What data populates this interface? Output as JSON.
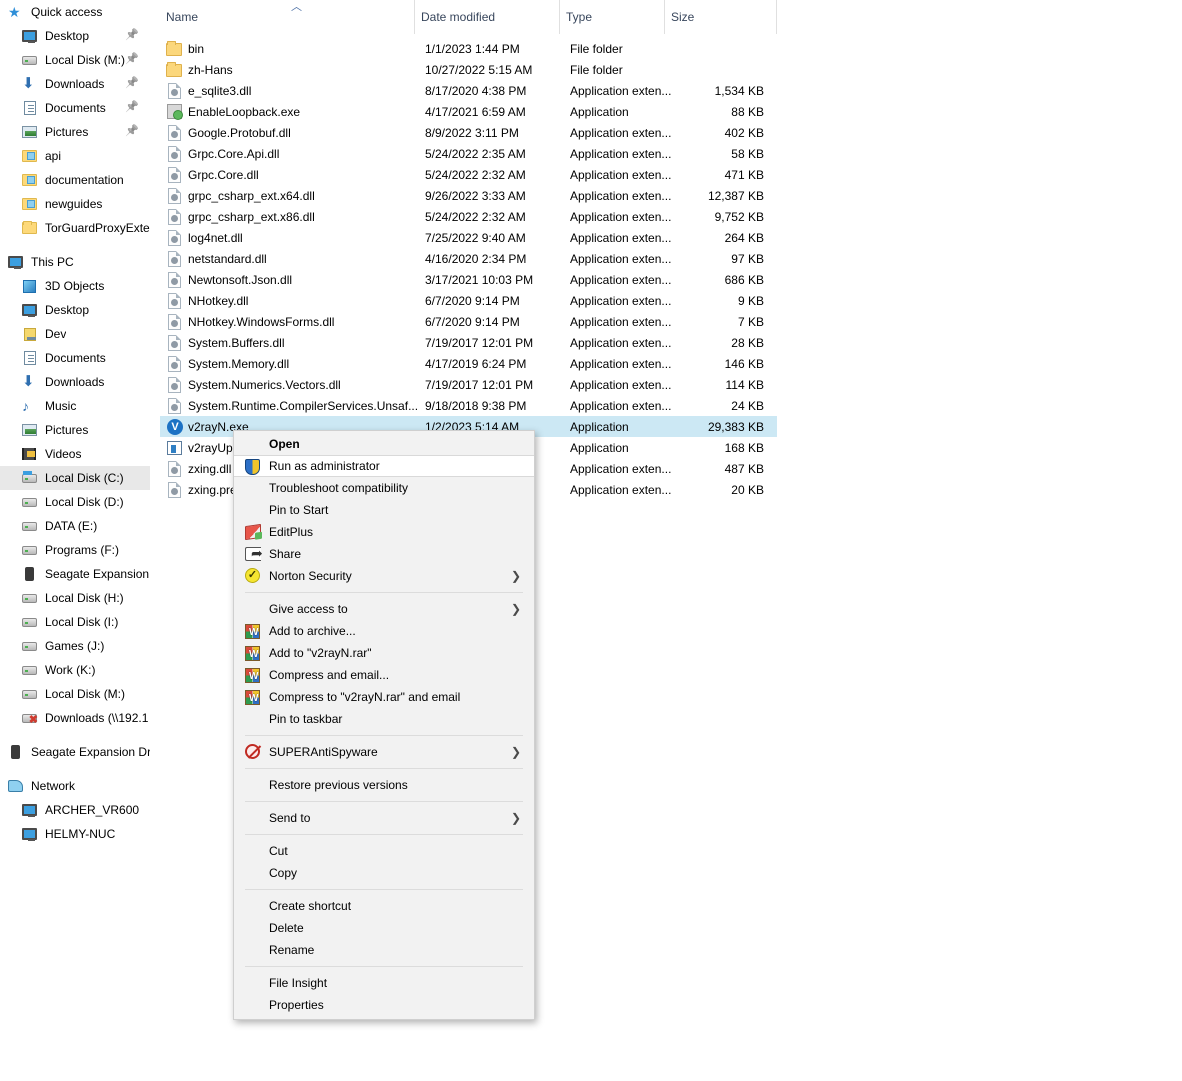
{
  "sidebar": {
    "groups": [
      {
        "name": "quick-access",
        "header": {
          "label": "Quick access",
          "icon": "star-icon",
          "level": 0
        },
        "items": [
          {
            "label": "Desktop",
            "icon": "monitor-icon",
            "pinned": true,
            "level": 1
          },
          {
            "label": "Local Disk (M:)",
            "icon": "drive-icon",
            "pinned": true,
            "level": 1
          },
          {
            "label": "Downloads",
            "icon": "download-arrow-icon",
            "pinned": true,
            "level": 1
          },
          {
            "label": "Documents",
            "icon": "documents-icon",
            "pinned": true,
            "level": 1
          },
          {
            "label": "Pictures",
            "icon": "pictures-icon",
            "pinned": true,
            "level": 1
          },
          {
            "label": "api",
            "icon": "folder-link-icon",
            "pinned": false,
            "level": 1
          },
          {
            "label": "documentation",
            "icon": "folder-link-icon",
            "pinned": false,
            "level": 1
          },
          {
            "label": "newguides",
            "icon": "folder-link-icon",
            "pinned": false,
            "level": 1
          },
          {
            "label": "TorGuardProxyExten",
            "icon": "folder-icon",
            "pinned": false,
            "level": 1
          }
        ]
      },
      {
        "name": "this-pc",
        "header": {
          "label": "This PC",
          "icon": "computer-icon",
          "level": 0
        },
        "items": [
          {
            "label": "3D Objects",
            "icon": "3d-objects-icon",
            "level": 1
          },
          {
            "label": "Desktop",
            "icon": "monitor-icon",
            "level": 1
          },
          {
            "label": "Dev",
            "icon": "dev-folder-icon",
            "level": 1
          },
          {
            "label": "Documents",
            "icon": "documents-icon",
            "level": 1
          },
          {
            "label": "Downloads",
            "icon": "download-arrow-icon",
            "level": 1
          },
          {
            "label": "Music",
            "icon": "music-note-icon",
            "level": 1
          },
          {
            "label": "Pictures",
            "icon": "pictures-icon",
            "level": 1
          },
          {
            "label": "Videos",
            "icon": "videos-icon",
            "level": 1
          },
          {
            "label": "Local Disk (C:)",
            "icon": "system-drive-icon",
            "level": 1,
            "selected": true
          },
          {
            "label": "Local Disk (D:)",
            "icon": "drive-icon",
            "level": 1
          },
          {
            "label": "DATA (E:)",
            "icon": "drive-icon",
            "level": 1
          },
          {
            "label": "Programs (F:)",
            "icon": "drive-icon",
            "level": 1
          },
          {
            "label": "Seagate Expansion I",
            "icon": "external-drive-icon",
            "level": 1
          },
          {
            "label": "Local Disk (H:)",
            "icon": "drive-icon",
            "level": 1
          },
          {
            "label": "Local Disk (I:)",
            "icon": "drive-icon",
            "level": 1
          },
          {
            "label": "Games (J:)",
            "icon": "drive-icon",
            "level": 1
          },
          {
            "label": "Work (K:)",
            "icon": "drive-icon",
            "level": 1
          },
          {
            "label": "Local Disk (M:)",
            "icon": "drive-icon",
            "level": 1
          },
          {
            "label": "Downloads (\\\\192.1",
            "icon": "disconnected-network-drive-icon",
            "level": 1
          }
        ]
      },
      {
        "name": "seagate-expansion",
        "header": {
          "label": "Seagate Expansion Dr",
          "icon": "external-drive-icon",
          "level": 0
        },
        "items": []
      },
      {
        "name": "network",
        "header": {
          "label": "Network",
          "icon": "network-icon",
          "level": 0
        },
        "items": [
          {
            "label": "ARCHER_VR600",
            "icon": "computer-icon",
            "level": 1
          },
          {
            "label": "HELMY-NUC",
            "icon": "computer-icon",
            "level": 1
          }
        ]
      }
    ]
  },
  "file_list": {
    "columns": [
      {
        "key": "name",
        "label": "Name",
        "sorted": "ascending"
      },
      {
        "key": "date",
        "label": "Date modified"
      },
      {
        "key": "type",
        "label": "Type"
      },
      {
        "key": "size",
        "label": "Size"
      }
    ],
    "rows": [
      {
        "name": "bin",
        "date": "1/1/2023 1:44 PM",
        "type": "File folder",
        "size": "",
        "icon": "folder-icon"
      },
      {
        "name": "zh-Hans",
        "date": "10/27/2022 5:15 AM",
        "type": "File folder",
        "size": "",
        "icon": "folder-icon"
      },
      {
        "name": "e_sqlite3.dll",
        "date": "8/17/2020 4:38 PM",
        "type": "Application exten...",
        "size": "1,534 KB",
        "icon": "dll-icon"
      },
      {
        "name": "EnableLoopback.exe",
        "date": "4/17/2021 6:59 AM",
        "type": "Application",
        "size": "88 KB",
        "icon": "exe-icon"
      },
      {
        "name": "Google.Protobuf.dll",
        "date": "8/9/2022 3:11 PM",
        "type": "Application exten...",
        "size": "402 KB",
        "icon": "dll-icon"
      },
      {
        "name": "Grpc.Core.Api.dll",
        "date": "5/24/2022 2:35 AM",
        "type": "Application exten...",
        "size": "58 KB",
        "icon": "dll-icon"
      },
      {
        "name": "Grpc.Core.dll",
        "date": "5/24/2022 2:32 AM",
        "type": "Application exten...",
        "size": "471 KB",
        "icon": "dll-icon"
      },
      {
        "name": "grpc_csharp_ext.x64.dll",
        "date": "9/26/2022 3:33 AM",
        "type": "Application exten...",
        "size": "12,387 KB",
        "icon": "dll-icon"
      },
      {
        "name": "grpc_csharp_ext.x86.dll",
        "date": "5/24/2022 2:32 AM",
        "type": "Application exten...",
        "size": "9,752 KB",
        "icon": "dll-icon"
      },
      {
        "name": "log4net.dll",
        "date": "7/25/2022 9:40 AM",
        "type": "Application exten...",
        "size": "264 KB",
        "icon": "dll-icon"
      },
      {
        "name": "netstandard.dll",
        "date": "4/16/2020 2:34 PM",
        "type": "Application exten...",
        "size": "97 KB",
        "icon": "dll-icon"
      },
      {
        "name": "Newtonsoft.Json.dll",
        "date": "3/17/2021 10:03 PM",
        "type": "Application exten...",
        "size": "686 KB",
        "icon": "dll-icon"
      },
      {
        "name": "NHotkey.dll",
        "date": "6/7/2020 9:14 PM",
        "type": "Application exten...",
        "size": "9 KB",
        "icon": "dll-icon"
      },
      {
        "name": "NHotkey.WindowsForms.dll",
        "date": "6/7/2020 9:14 PM",
        "type": "Application exten...",
        "size": "7 KB",
        "icon": "dll-icon"
      },
      {
        "name": "System.Buffers.dll",
        "date": "7/19/2017 12:01 PM",
        "type": "Application exten...",
        "size": "28 KB",
        "icon": "dll-icon"
      },
      {
        "name": "System.Memory.dll",
        "date": "4/17/2019 6:24 PM",
        "type": "Application exten...",
        "size": "146 KB",
        "icon": "dll-icon"
      },
      {
        "name": "System.Numerics.Vectors.dll",
        "date": "7/19/2017 12:01 PM",
        "type": "Application exten...",
        "size": "114 KB",
        "icon": "dll-icon"
      },
      {
        "name": "System.Runtime.CompilerServices.Unsaf...",
        "date": "9/18/2018 9:38 PM",
        "type": "Application exten...",
        "size": "24 KB",
        "icon": "dll-icon"
      },
      {
        "name": "v2rayN.exe",
        "date": "1/2/2023 5:14 AM",
        "type": "Application",
        "size": "29,383 KB",
        "icon": "v2rayn-icon",
        "selected": true
      },
      {
        "name": "v2rayUpgrade.exe",
        "date": "",
        "type": "Application",
        "size": "168 KB",
        "icon": "v2rayupgrade-icon"
      },
      {
        "name": "zxing.dll",
        "date": "",
        "type": "Application exten...",
        "size": "487 KB",
        "icon": "dll-icon"
      },
      {
        "name": "zxing.pre",
        "date": "",
        "type": "Application exten...",
        "size": "20 KB",
        "icon": "dll-icon"
      }
    ]
  },
  "context_menu": {
    "items": [
      {
        "label": "Open",
        "bold": true,
        "icon": null,
        "submenu": false
      },
      {
        "label": "Run as administrator",
        "icon": "shield-icon",
        "submenu": false,
        "hovered": true
      },
      {
        "label": "Troubleshoot compatibility",
        "icon": null,
        "submenu": false
      },
      {
        "label": "Pin to Start",
        "icon": null,
        "submenu": false
      },
      {
        "label": "EditPlus",
        "icon": "editplus-icon",
        "submenu": false
      },
      {
        "label": "Share",
        "icon": "share-icon",
        "submenu": false
      },
      {
        "label": "Norton Security",
        "icon": "norton-icon",
        "submenu": true
      },
      {
        "separator": true
      },
      {
        "label": "Give access to",
        "icon": null,
        "submenu": true
      },
      {
        "label": "Add to archive...",
        "icon": "winrar-icon",
        "submenu": false
      },
      {
        "label": "Add to \"v2rayN.rar\"",
        "icon": "winrar-icon",
        "submenu": false
      },
      {
        "label": "Compress and email...",
        "icon": "winrar-icon",
        "submenu": false
      },
      {
        "label": "Compress to \"v2rayN.rar\" and email",
        "icon": "winrar-icon",
        "submenu": false
      },
      {
        "label": "Pin to taskbar",
        "icon": null,
        "submenu": false
      },
      {
        "separator": true
      },
      {
        "label": "SUPERAntiSpyware",
        "icon": "superantispyware-icon",
        "submenu": true
      },
      {
        "separator": true
      },
      {
        "label": "Restore previous versions",
        "icon": null,
        "submenu": false
      },
      {
        "separator": true
      },
      {
        "label": "Send to",
        "icon": null,
        "submenu": true
      },
      {
        "separator": true
      },
      {
        "label": "Cut",
        "icon": null,
        "submenu": false
      },
      {
        "label": "Copy",
        "icon": null,
        "submenu": false
      },
      {
        "separator": true
      },
      {
        "label": "Create shortcut",
        "icon": null,
        "submenu": false
      },
      {
        "label": "Delete",
        "icon": null,
        "submenu": false
      },
      {
        "label": "Rename",
        "icon": null,
        "submenu": false
      },
      {
        "separator": true
      },
      {
        "label": "File Insight",
        "icon": null,
        "submenu": false
      },
      {
        "label": "Properties",
        "icon": null,
        "submenu": false
      }
    ],
    "submenu_arrow": "❯"
  },
  "colors": {
    "selection_blue": "#cce8f4",
    "sidebar_selection": "#e8e8e8",
    "menu_background": "#f2f2f2",
    "menu_hover": "#ffffff",
    "header_text": "#38465c"
  }
}
